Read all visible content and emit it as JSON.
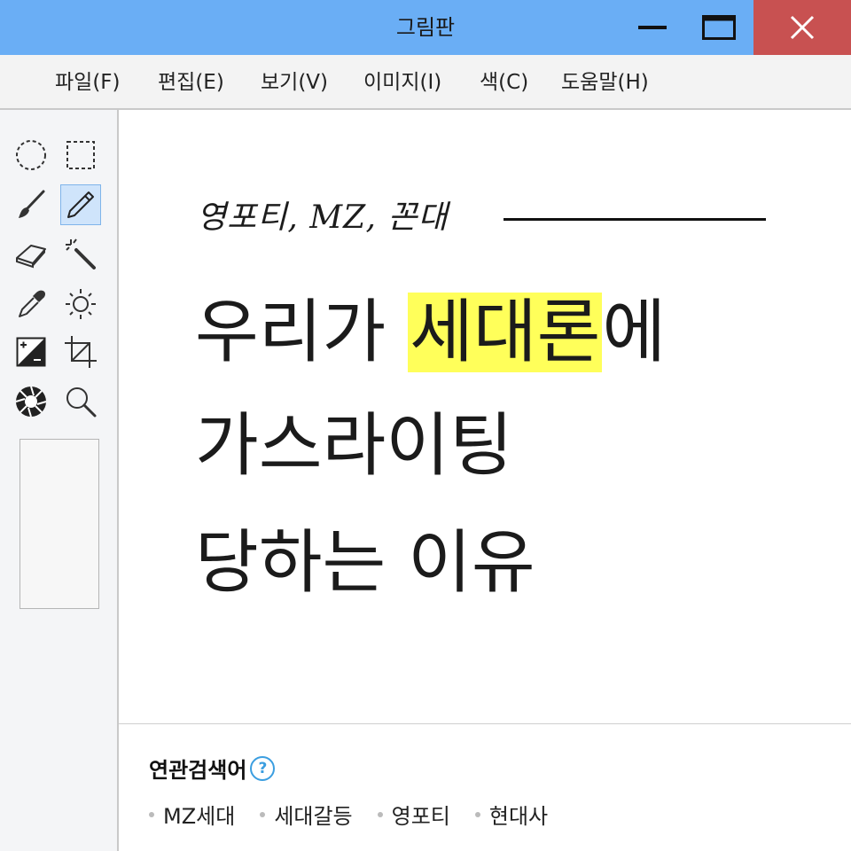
{
  "window": {
    "title": "그림판"
  },
  "menu": [
    "파일(F)",
    "편집(E)",
    "보기(V)",
    "이미지(I)",
    "색(C)",
    "도움말(H)"
  ],
  "tools": [
    {
      "icon": "ellipse-select-icon"
    },
    {
      "icon": "rect-select-icon"
    },
    {
      "icon": "brush-icon"
    },
    {
      "icon": "pencil-icon",
      "selected": true
    },
    {
      "icon": "eraser-icon"
    },
    {
      "icon": "magic-wand-icon"
    },
    {
      "icon": "color-picker-icon"
    },
    {
      "icon": "brightness-icon"
    },
    {
      "icon": "exposure-icon"
    },
    {
      "icon": "crop-icon"
    },
    {
      "icon": "aperture-icon"
    },
    {
      "icon": "zoom-icon"
    }
  ],
  "canvas": {
    "subtitle": "영포티, MZ, 꼰대",
    "line1_a": "우리가 ",
    "line1_highlight": "세대론",
    "line1_b": "에",
    "line2": "가스라이팅",
    "line3": "당하는 이유",
    "highlight_color": "#ffff5a"
  },
  "related": {
    "title": "연관검색어",
    "help": "?",
    "items": [
      "MZ세대",
      "세대갈등",
      "영포티",
      "현대사"
    ]
  }
}
